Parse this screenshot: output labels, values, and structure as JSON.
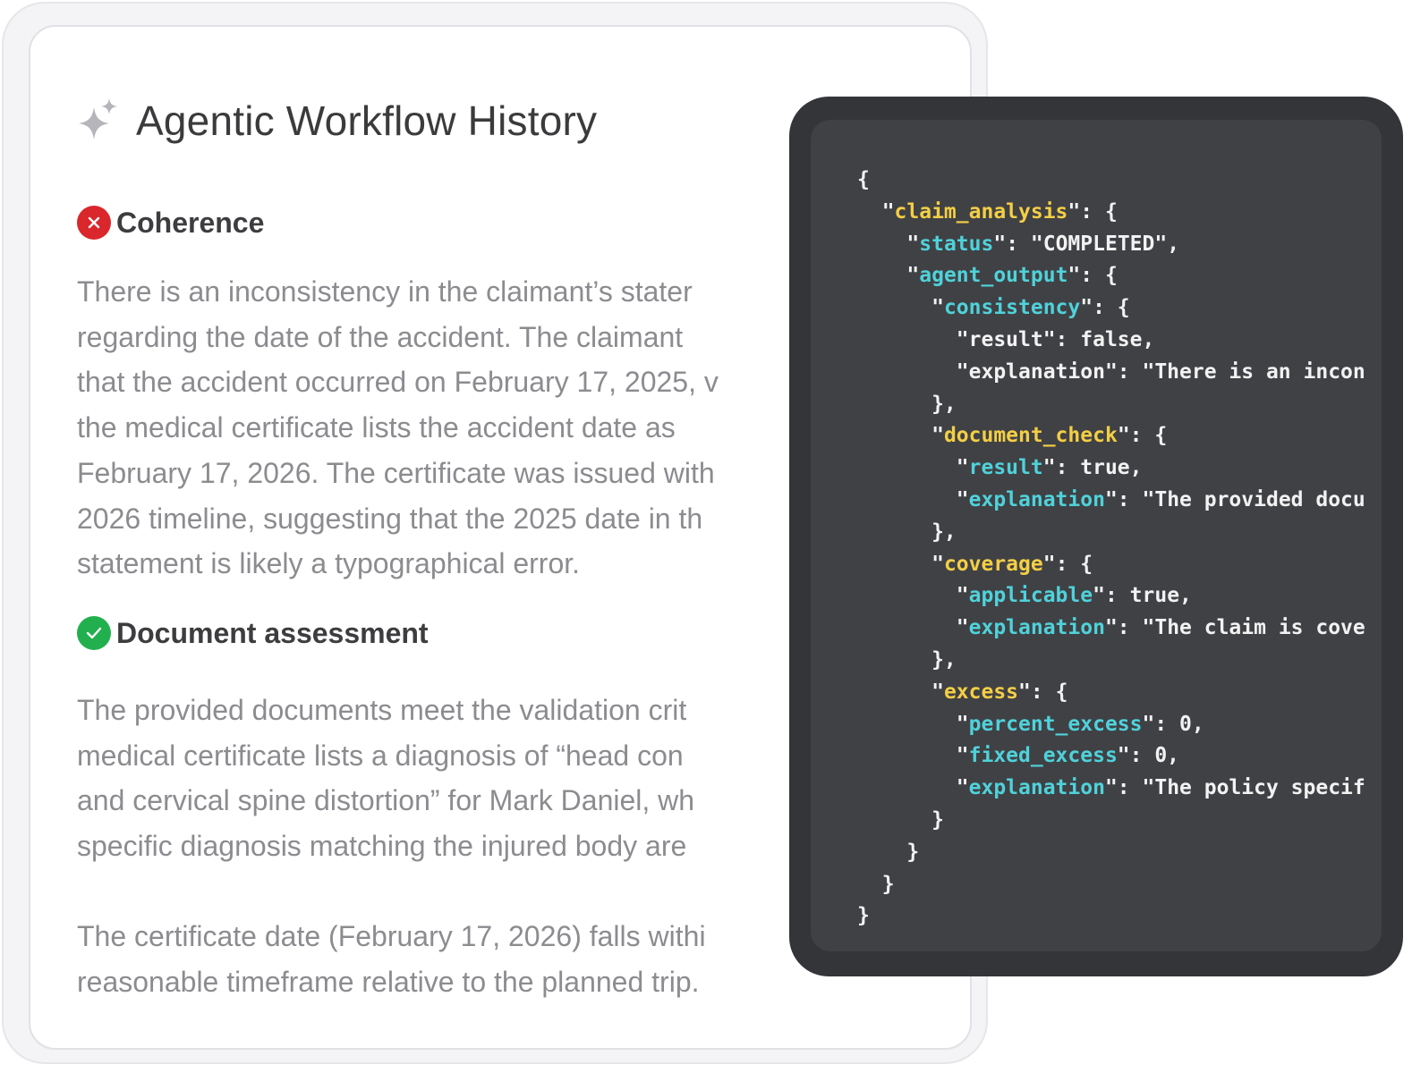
{
  "header": {
    "title": "Agentic Workflow History",
    "icon": "sparkle-icon"
  },
  "sections": [
    {
      "status": "fail",
      "status_icon": "x-circle-icon",
      "status_color": "#d9272b",
      "title": "Coherence",
      "paragraphs": [
        [
          "There is an inconsistency in the claimant’s stater",
          "regarding the date of the accident. The claimant",
          "that the accident occurred on February 17, 2025, v",
          "the medical certificate lists the accident date as",
          "February 17, 2026. The certificate was issued with",
          "2026 timeline, suggesting that the 2025 date in th",
          "statement is likely a typographical error."
        ]
      ]
    },
    {
      "status": "pass",
      "status_icon": "check-circle-icon",
      "status_color": "#22b04e",
      "title": "Document assessment",
      "paragraphs": [
        [
          "The provided documents meet the validation crit",
          "medical certificate lists a diagnosis of “head con",
          "and cervical spine distortion” for Mark Daniel, wh",
          "specific diagnosis matching the injured body are"
        ],
        [
          "The certificate date (February 17, 2026) falls withi",
          "reasonable timeframe relative to the planned trip."
        ]
      ]
    }
  ],
  "code": {
    "colors": {
      "top_key": "#f3cf45",
      "nested_key": "#4fd2da",
      "text": "#f2f2f2"
    },
    "lines": [
      [
        {
          "t": "{",
          "c": "w"
        }
      ],
      [
        {
          "t": "  \"",
          "c": "w"
        },
        {
          "t": "claim_analysis",
          "c": "y"
        },
        {
          "t": "\": {",
          "c": "w"
        }
      ],
      [
        {
          "t": "    \"",
          "c": "w"
        },
        {
          "t": "status",
          "c": "c"
        },
        {
          "t": "\": \"COMPLETED\",",
          "c": "w"
        }
      ],
      [
        {
          "t": "    \"",
          "c": "w"
        },
        {
          "t": "agent_output",
          "c": "c"
        },
        {
          "t": "\": {",
          "c": "w"
        }
      ],
      [
        {
          "t": "      \"",
          "c": "w"
        },
        {
          "t": "consistency",
          "c": "c"
        },
        {
          "t": "\": {",
          "c": "w"
        }
      ],
      [
        {
          "t": "        \"result\": false,",
          "c": "w"
        }
      ],
      [
        {
          "t": "        \"explanation\": \"There is an incon",
          "c": "w"
        }
      ],
      [
        {
          "t": "      },",
          "c": "w"
        }
      ],
      [
        {
          "t": "      \"",
          "c": "w"
        },
        {
          "t": "document_check",
          "c": "y"
        },
        {
          "t": "\": {",
          "c": "w"
        }
      ],
      [
        {
          "t": "        \"",
          "c": "w"
        },
        {
          "t": "result",
          "c": "c"
        },
        {
          "t": "\": true,",
          "c": "w"
        }
      ],
      [
        {
          "t": "        \"",
          "c": "w"
        },
        {
          "t": "explanation",
          "c": "c"
        },
        {
          "t": "\": \"The provided docu",
          "c": "w"
        }
      ],
      [
        {
          "t": "      },",
          "c": "w"
        }
      ],
      [
        {
          "t": "      \"",
          "c": "w"
        },
        {
          "t": "coverage",
          "c": "y"
        },
        {
          "t": "\": {",
          "c": "w"
        }
      ],
      [
        {
          "t": "        \"",
          "c": "w"
        },
        {
          "t": "applicable",
          "c": "c"
        },
        {
          "t": "\": true,",
          "c": "w"
        }
      ],
      [
        {
          "t": "        \"",
          "c": "w"
        },
        {
          "t": "explanation",
          "c": "c"
        },
        {
          "t": "\": \"The claim is cove",
          "c": "w"
        }
      ],
      [
        {
          "t": "      },",
          "c": "w"
        }
      ],
      [
        {
          "t": "      \"",
          "c": "w"
        },
        {
          "t": "excess",
          "c": "y"
        },
        {
          "t": "\": {",
          "c": "w"
        }
      ],
      [
        {
          "t": "        \"",
          "c": "w"
        },
        {
          "t": "percent_excess",
          "c": "c"
        },
        {
          "t": "\": 0,",
          "c": "w"
        }
      ],
      [
        {
          "t": "        \"",
          "c": "w"
        },
        {
          "t": "fixed_excess",
          "c": "c"
        },
        {
          "t": "\": 0,",
          "c": "w"
        }
      ],
      [
        {
          "t": "        \"",
          "c": "w"
        },
        {
          "t": "explanation",
          "c": "c"
        },
        {
          "t": "\": \"The policy specif",
          "c": "w"
        }
      ],
      [
        {
          "t": "      }",
          "c": "w"
        }
      ],
      [
        {
          "t": "    }",
          "c": "w"
        }
      ],
      [
        {
          "t": "  }",
          "c": "w"
        }
      ],
      [
        {
          "t": "}",
          "c": "w"
        }
      ]
    ]
  }
}
